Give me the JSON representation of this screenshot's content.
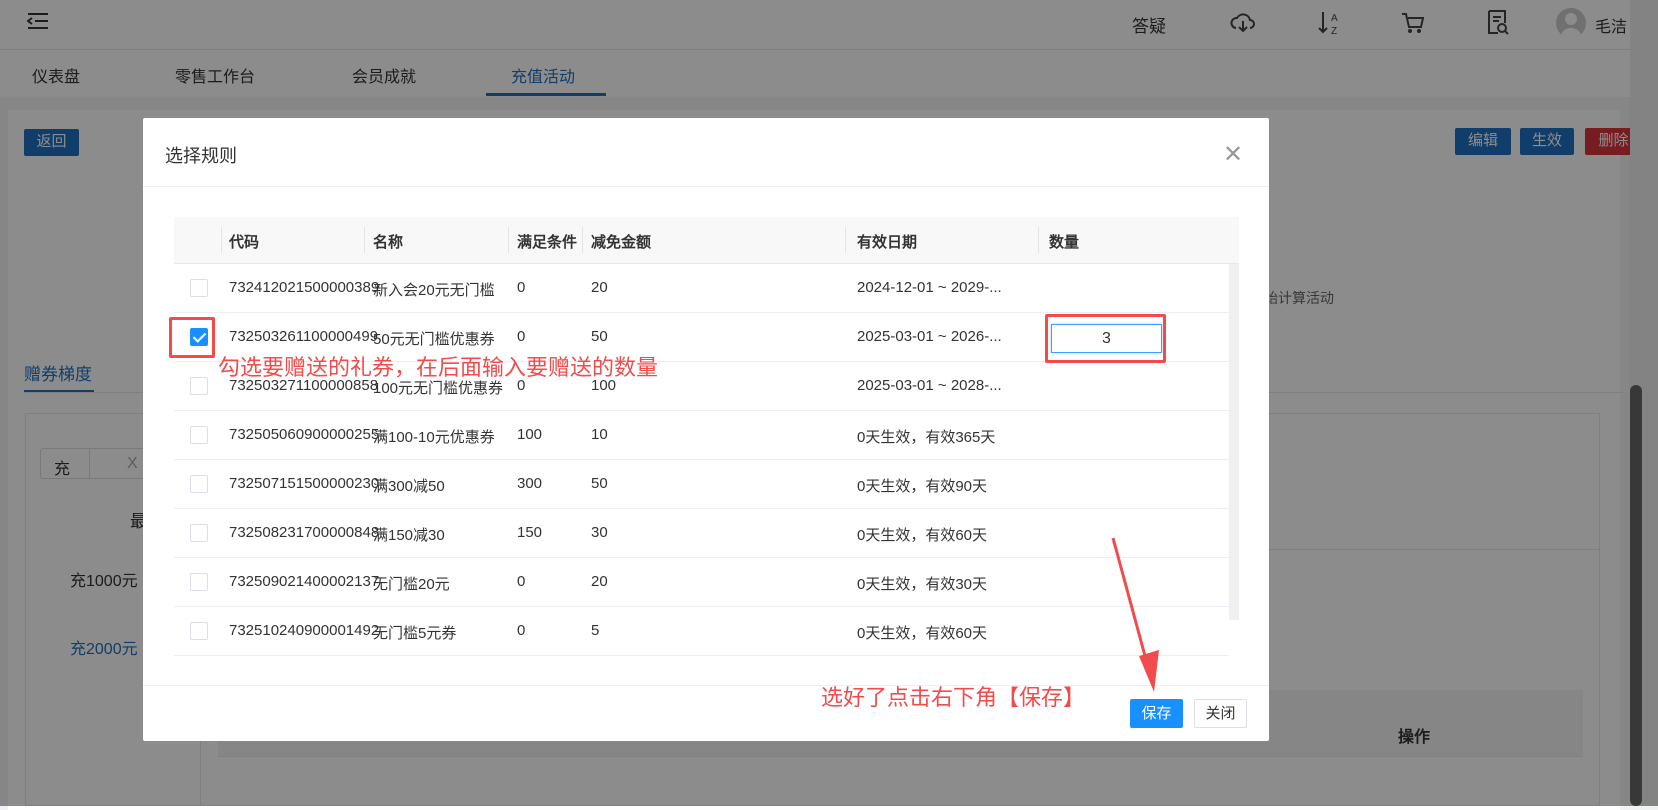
{
  "header": {
    "menu_icon": "menu-fold-icon",
    "qa_label": "答疑",
    "icons": [
      "cloud-download-icon",
      "sort-az-icon",
      "cart-icon",
      "report-search-icon"
    ],
    "user_name": "毛洁"
  },
  "tabs": [
    {
      "label": "仪表盘"
    },
    {
      "label": "零售工作台"
    },
    {
      "label": "会员成就"
    },
    {
      "label": "充值活动",
      "active": true
    }
  ],
  "page": {
    "back_label": "返回",
    "edit_label": "编辑",
    "activate_label": "生效",
    "delete_label": "删除",
    "hint_fragment": "始计算活动",
    "section_tab": "赠券梯度",
    "input_prefix": "充",
    "input_placeholder": "X",
    "col_fragment": "最",
    "tiers": [
      "充1000元",
      "充2000元"
    ],
    "action_header": "操作"
  },
  "dialog": {
    "title": "选择规则",
    "columns": [
      "代码",
      "名称",
      "满足条件",
      "减免金额",
      "有效日期",
      "数量"
    ],
    "rows": [
      {
        "checked": false,
        "code": "732412021500000389",
        "name": "新入会20元无门槛",
        "cond": "0",
        "amount": "20",
        "valid": "2024-12-01 ~ 2029-...",
        "qty": ""
      },
      {
        "checked": true,
        "code": "732503261100000499",
        "name": "50元无门槛优惠券",
        "cond": "0",
        "amount": "50",
        "valid": "2025-03-01 ~ 2026-...",
        "qty": "3"
      },
      {
        "checked": false,
        "code": "732503271100000858",
        "name": "100元无门槛优惠券",
        "cond": "0",
        "amount": "100",
        "valid": "2025-03-01 ~ 2028-...",
        "qty": ""
      },
      {
        "checked": false,
        "code": "732505060900000255",
        "name": "满100-10元优惠券",
        "cond": "100",
        "amount": "10",
        "valid": "0天生效，有效365天",
        "qty": ""
      },
      {
        "checked": false,
        "code": "732507151500000230",
        "name": "满300减50",
        "cond": "300",
        "amount": "50",
        "valid": "0天生效，有效90天",
        "qty": ""
      },
      {
        "checked": false,
        "code": "732508231700000848",
        "name": "满150减30",
        "cond": "150",
        "amount": "30",
        "valid": "0天生效，有效60天",
        "qty": ""
      },
      {
        "checked": false,
        "code": "732509021400002137",
        "name": "无门槛20元",
        "cond": "0",
        "amount": "20",
        "valid": "0天生效，有效30天",
        "qty": ""
      },
      {
        "checked": false,
        "code": "732510240900001492",
        "name": "无门槛5元券",
        "cond": "0",
        "amount": "5",
        "valid": "0天生效，有效60天",
        "qty": ""
      }
    ],
    "save_label": "保存",
    "close_label": "关闭"
  },
  "annotations": {
    "select_hint": "勾选要赠送的礼券，在后面输入要赠送的数量",
    "save_hint": "选好了点击右下角【保存】"
  },
  "colors": {
    "primary": "#1890ff",
    "blue": "#1f6fc2",
    "danger": "#d9363e",
    "annotation": "#f24b4b"
  }
}
